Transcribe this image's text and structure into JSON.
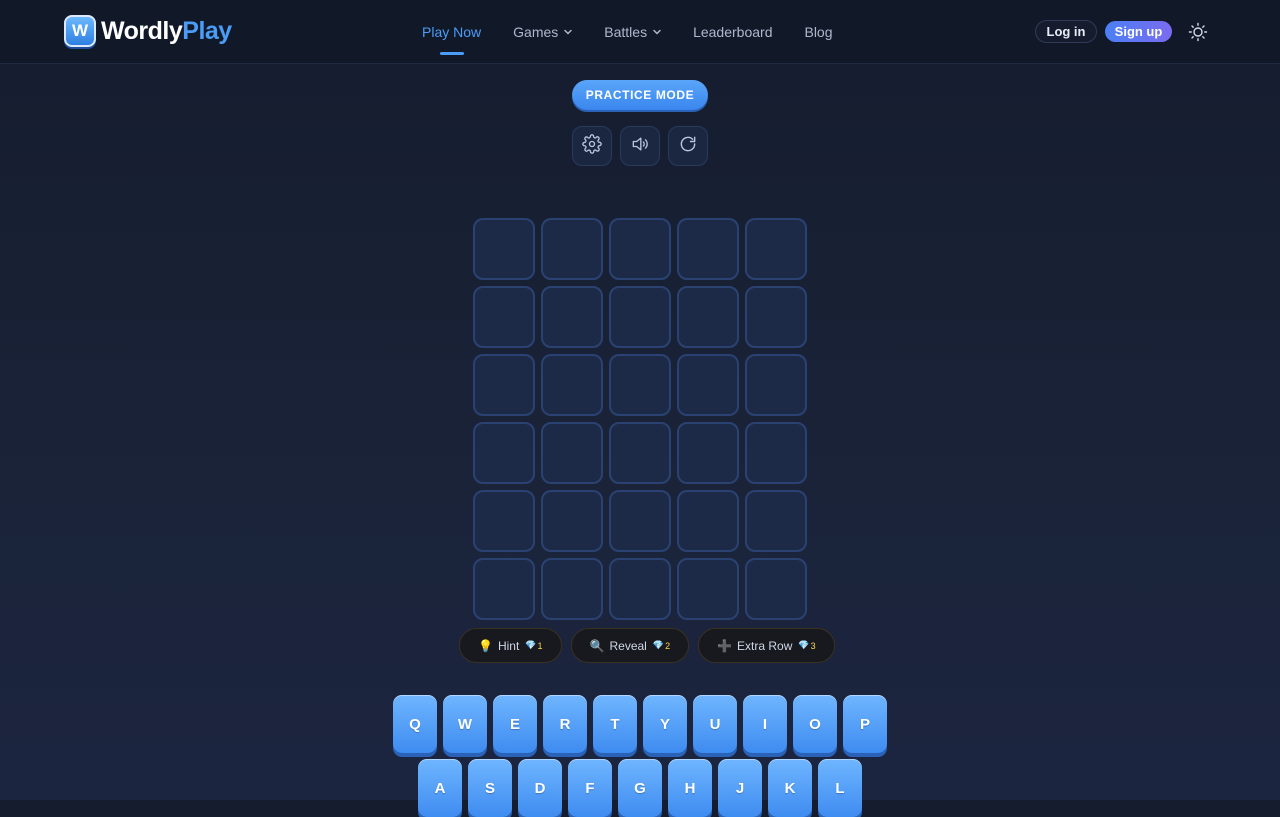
{
  "brand": {
    "badge": "W",
    "name_part1": "Wordly",
    "name_part2": "Play"
  },
  "nav": {
    "items": [
      {
        "label": "Play Now",
        "active": true,
        "dropdown": false
      },
      {
        "label": "Games",
        "active": false,
        "dropdown": true
      },
      {
        "label": "Battles",
        "active": false,
        "dropdown": true
      },
      {
        "label": "Leaderboard",
        "active": false,
        "dropdown": false
      },
      {
        "label": "Blog",
        "active": false,
        "dropdown": false
      }
    ],
    "login_label": "Log in",
    "signup_label": "Sign up",
    "theme_icon": "sun-icon"
  },
  "game": {
    "mode_label": "PRACTICE MODE",
    "tools": [
      {
        "name": "settings-button",
        "icon": "gear-icon"
      },
      {
        "name": "sound-button",
        "icon": "speaker-icon"
      },
      {
        "name": "restart-button",
        "icon": "refresh-icon"
      }
    ],
    "grid": {
      "rows": 6,
      "cols": 5,
      "letters": []
    },
    "powerups": [
      {
        "emoji": "💡",
        "label": "Hint",
        "gem": "💎",
        "cost": "1"
      },
      {
        "emoji": "🔍",
        "label": "Reveal",
        "gem": "💎",
        "cost": "2"
      },
      {
        "emoji": "➕",
        "label": "Extra Row",
        "gem": "💎",
        "cost": "3"
      }
    ]
  },
  "keyboard": {
    "row1": [
      "Q",
      "W",
      "E",
      "R",
      "T",
      "Y",
      "U",
      "I",
      "O",
      "P"
    ],
    "row2": [
      "A",
      "S",
      "D",
      "F",
      "G",
      "H",
      "J",
      "K",
      "L"
    ]
  },
  "colors": {
    "accent": "#4a9cf6",
    "tile_border": "#2a4272",
    "key_top": "#6fb5ff",
    "key_bottom": "#3e8cf0"
  }
}
